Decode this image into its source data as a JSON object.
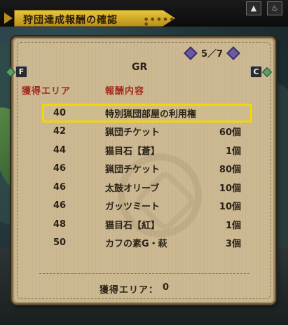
{
  "window": {
    "title": "狩団達成報酬の確認"
  },
  "pager": {
    "current": "5",
    "total": "7",
    "text": "5／7"
  },
  "rank_label": "GR",
  "nav_keys": {
    "left": "F",
    "right": "C"
  },
  "columns": {
    "area": "獲得エリア",
    "reward": "報酬内容"
  },
  "rewards": [
    {
      "area": "40",
      "name": "特別猟団部屋の利用権",
      "qty": "",
      "highlighted": true
    },
    {
      "area": "42",
      "name": "猟団チケット",
      "qty": "60個"
    },
    {
      "area": "44",
      "name": "猫目石【蒼】",
      "qty": "1個"
    },
    {
      "area": "46",
      "name": "猟団チケット",
      "qty": "80個"
    },
    {
      "area": "46",
      "name": "太鼓オリーブ",
      "qty": "10個"
    },
    {
      "area": "46",
      "name": "ガッツミート",
      "qty": "10個"
    },
    {
      "area": "48",
      "name": "猫目石【紅】",
      "qty": "1個"
    },
    {
      "area": "50",
      "name": "カフの素G・萩",
      "qty": "3個"
    }
  ],
  "summary": {
    "label": "獲得エリア：",
    "value": "0"
  },
  "colors": {
    "header_red": "#a32a1c",
    "highlight_yellow": "#f2d60a",
    "panel_bg": "#c8b58d",
    "title_gold": "#d8b42a"
  },
  "icons": [
    "arrow-left-icon",
    "arrow-right-icon",
    "f-key-icon",
    "c-key-icon",
    "mountain-icon",
    "fire-icon"
  ]
}
